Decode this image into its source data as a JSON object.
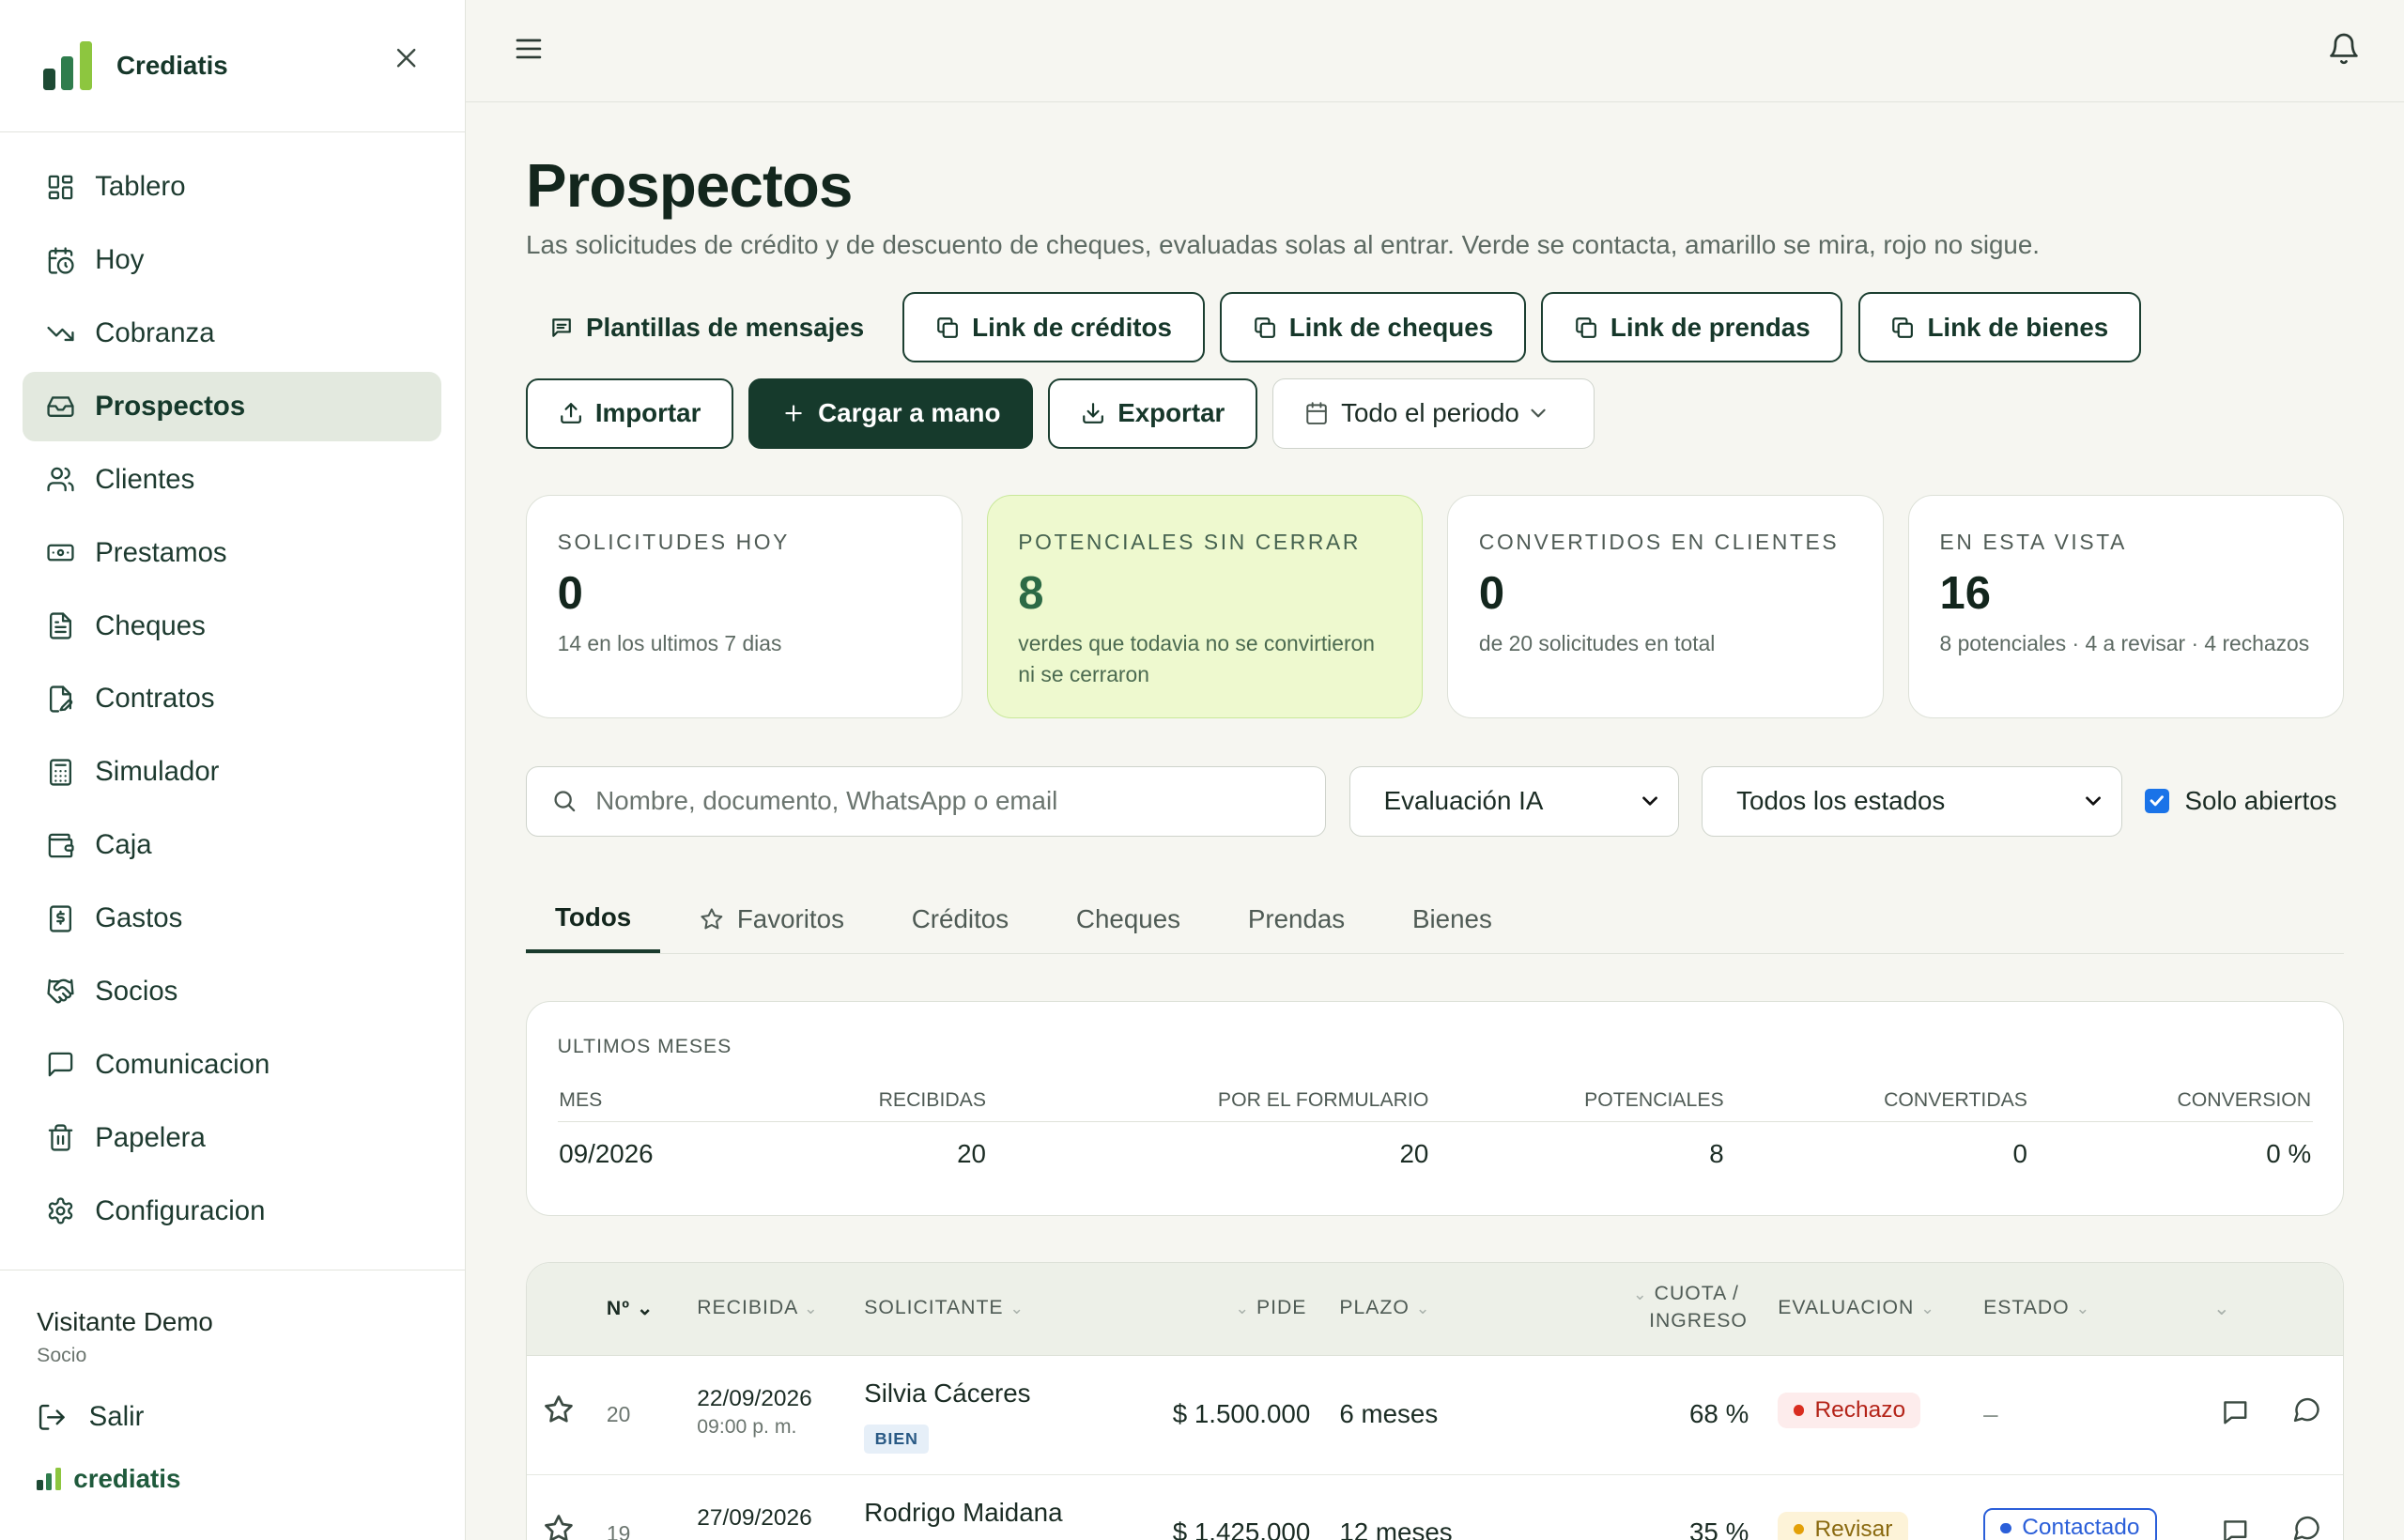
{
  "app": {
    "name": "Crediatis",
    "footer_name": "crediatis",
    "accent": "#163a2c",
    "logo_colors": [
      "#1d4a34",
      "#2f7d4d",
      "#8dc63f"
    ]
  },
  "sidebar": {
    "items": [
      {
        "label": "Tablero",
        "icon": "dashboard-icon"
      },
      {
        "label": "Hoy",
        "icon": "calendar-clock-icon"
      },
      {
        "label": "Cobranza",
        "icon": "trending-down-icon"
      },
      {
        "label": "Prospectos",
        "icon": "inbox-icon",
        "active": true
      },
      {
        "label": "Clientes",
        "icon": "users-icon"
      },
      {
        "label": "Prestamos",
        "icon": "banknote-icon"
      },
      {
        "label": "Cheques",
        "icon": "file-text-icon"
      },
      {
        "label": "Contratos",
        "icon": "file-signature-icon"
      },
      {
        "label": "Simulador",
        "icon": "calculator-icon"
      },
      {
        "label": "Caja",
        "icon": "wallet-icon"
      },
      {
        "label": "Gastos",
        "icon": "receipt-dollar-icon"
      },
      {
        "label": "Socios",
        "icon": "handshake-icon"
      },
      {
        "label": "Comunicacion",
        "icon": "message-square-icon"
      },
      {
        "label": "Papelera",
        "icon": "trash-icon"
      },
      {
        "label": "Configuracion",
        "icon": "settings-icon"
      }
    ],
    "user": {
      "name": "Visitante Demo",
      "role": "Socio"
    },
    "logout": "Salir"
  },
  "page": {
    "title": "Prospectos",
    "subtitle": "Las solicitudes de crédito y de descuento de cheques, evaluadas solas al entrar. Verde se contacta, amarillo se mira, rojo no sigue."
  },
  "actions": {
    "templates": "Plantillas de mensajes",
    "link_creditos": "Link de créditos",
    "link_cheques": "Link de cheques",
    "link_prendas": "Link de prendas",
    "link_bienes": "Link de bienes",
    "importar": "Importar",
    "cargar": "Cargar a mano",
    "exportar": "Exportar",
    "periodo": "Todo el periodo"
  },
  "stats": [
    {
      "label": "SOLICITUDES HOY",
      "value": "0",
      "desc": "14 en los ultimos 7 dias"
    },
    {
      "label": "POTENCIALES SIN CERRAR",
      "value": "8",
      "desc": "verdes que todavia no se convirtieron ni se cerraron"
    },
    {
      "label": "CONVERTIDOS EN CLIENTES",
      "value": "0",
      "desc": "de 20 solicitudes en total"
    },
    {
      "label": "EN ESTA VISTA",
      "value": "16",
      "desc": "8 potenciales · 4 a revisar · 4 rechazos"
    }
  ],
  "filters": {
    "search_placeholder": "Nombre, documento, WhatsApp o email",
    "evaluacion": "Evaluación IA",
    "estados": "Todos los estados",
    "solo_abiertos": "Solo abiertos"
  },
  "tabs": [
    "Todos",
    "Favoritos",
    "Créditos",
    "Cheques",
    "Prendas",
    "Bienes"
  ],
  "months": {
    "title": "ULTIMOS MESES",
    "headers": [
      "MES",
      "RECIBIDAS",
      "POR EL FORMULARIO",
      "POTENCIALES",
      "CONVERTIDAS",
      "CONVERSION"
    ],
    "rows": [
      [
        "09/2026",
        "20",
        "20",
        "8",
        "0",
        "0 %"
      ]
    ]
  },
  "list": {
    "headers": {
      "num": "Nº",
      "recibida": "RECIBIDA",
      "solicitante": "SOLICITANTE",
      "pide": "PIDE",
      "plazo": "PLAZO",
      "cuota1": "CUOTA /",
      "cuota2": "INGRESO",
      "evaluacion": "EVALUACION",
      "estado": "ESTADO"
    },
    "rows": [
      {
        "num": "20",
        "date": "22/09/2026",
        "time": "09:00 p. m.",
        "name": "Silvia Cáceres",
        "badge": "BIEN",
        "amount": "$ 1.500.000",
        "plazo": "6 meses",
        "cuota": "68 %",
        "eval": "Rechazo",
        "estado": "–"
      },
      {
        "num": "19",
        "date": "27/09/2026",
        "time": "",
        "name": "Rodrigo Maidana",
        "badge": "",
        "amount": "$ 1.425.000",
        "plazo": "12 meses",
        "cuota": "35 %",
        "eval": "Revisar",
        "estado": "Contactado"
      }
    ]
  }
}
